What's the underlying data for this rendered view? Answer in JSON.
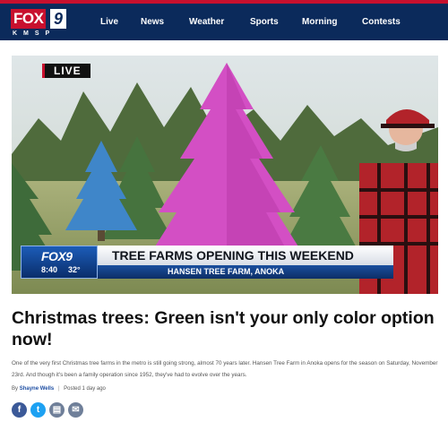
{
  "header": {
    "logo_main": "FOX",
    "logo_number": "9",
    "logo_callsign": "KMSP",
    "nav": [
      "Live",
      "News",
      "Weather",
      "Sports",
      "Morning",
      "Contests"
    ]
  },
  "video": {
    "live_badge": "LIVE",
    "lower_third": {
      "logo": "FOX9",
      "time": "8:40",
      "temperature": "32°",
      "headline": "TREE FARMS OPENING THIS WEEKEND",
      "subline": "HANSEN TREE FARM, ANOKA"
    }
  },
  "article": {
    "title": "Christmas trees: Green isn't your only color option now!",
    "summary": "One of the very first Christmas tree farms in the metro is still going strong, almost 70 years later. Hansen Tree Farm in Anoka opens for the season on Saturday, November 23rd. And though it's been a family operation since 1952, they've had to evolve over the years.",
    "byline_prefix": "By",
    "author": "Shayne Wells",
    "separator": "|",
    "posted": "Posted 1 day ago"
  },
  "share": [
    {
      "icon": "facebook-icon",
      "glyph": "f",
      "color": "#3b5998"
    },
    {
      "icon": "twitter-icon",
      "glyph": "t",
      "color": "#1da1f2"
    },
    {
      "icon": "print-icon",
      "glyph": "▤",
      "color": "#6f7f99"
    },
    {
      "icon": "email-icon",
      "glyph": "✉",
      "color": "#6f7f99"
    }
  ],
  "colors": {
    "brand_red": "#c8102e",
    "header_navy": "#0b2a5b"
  }
}
